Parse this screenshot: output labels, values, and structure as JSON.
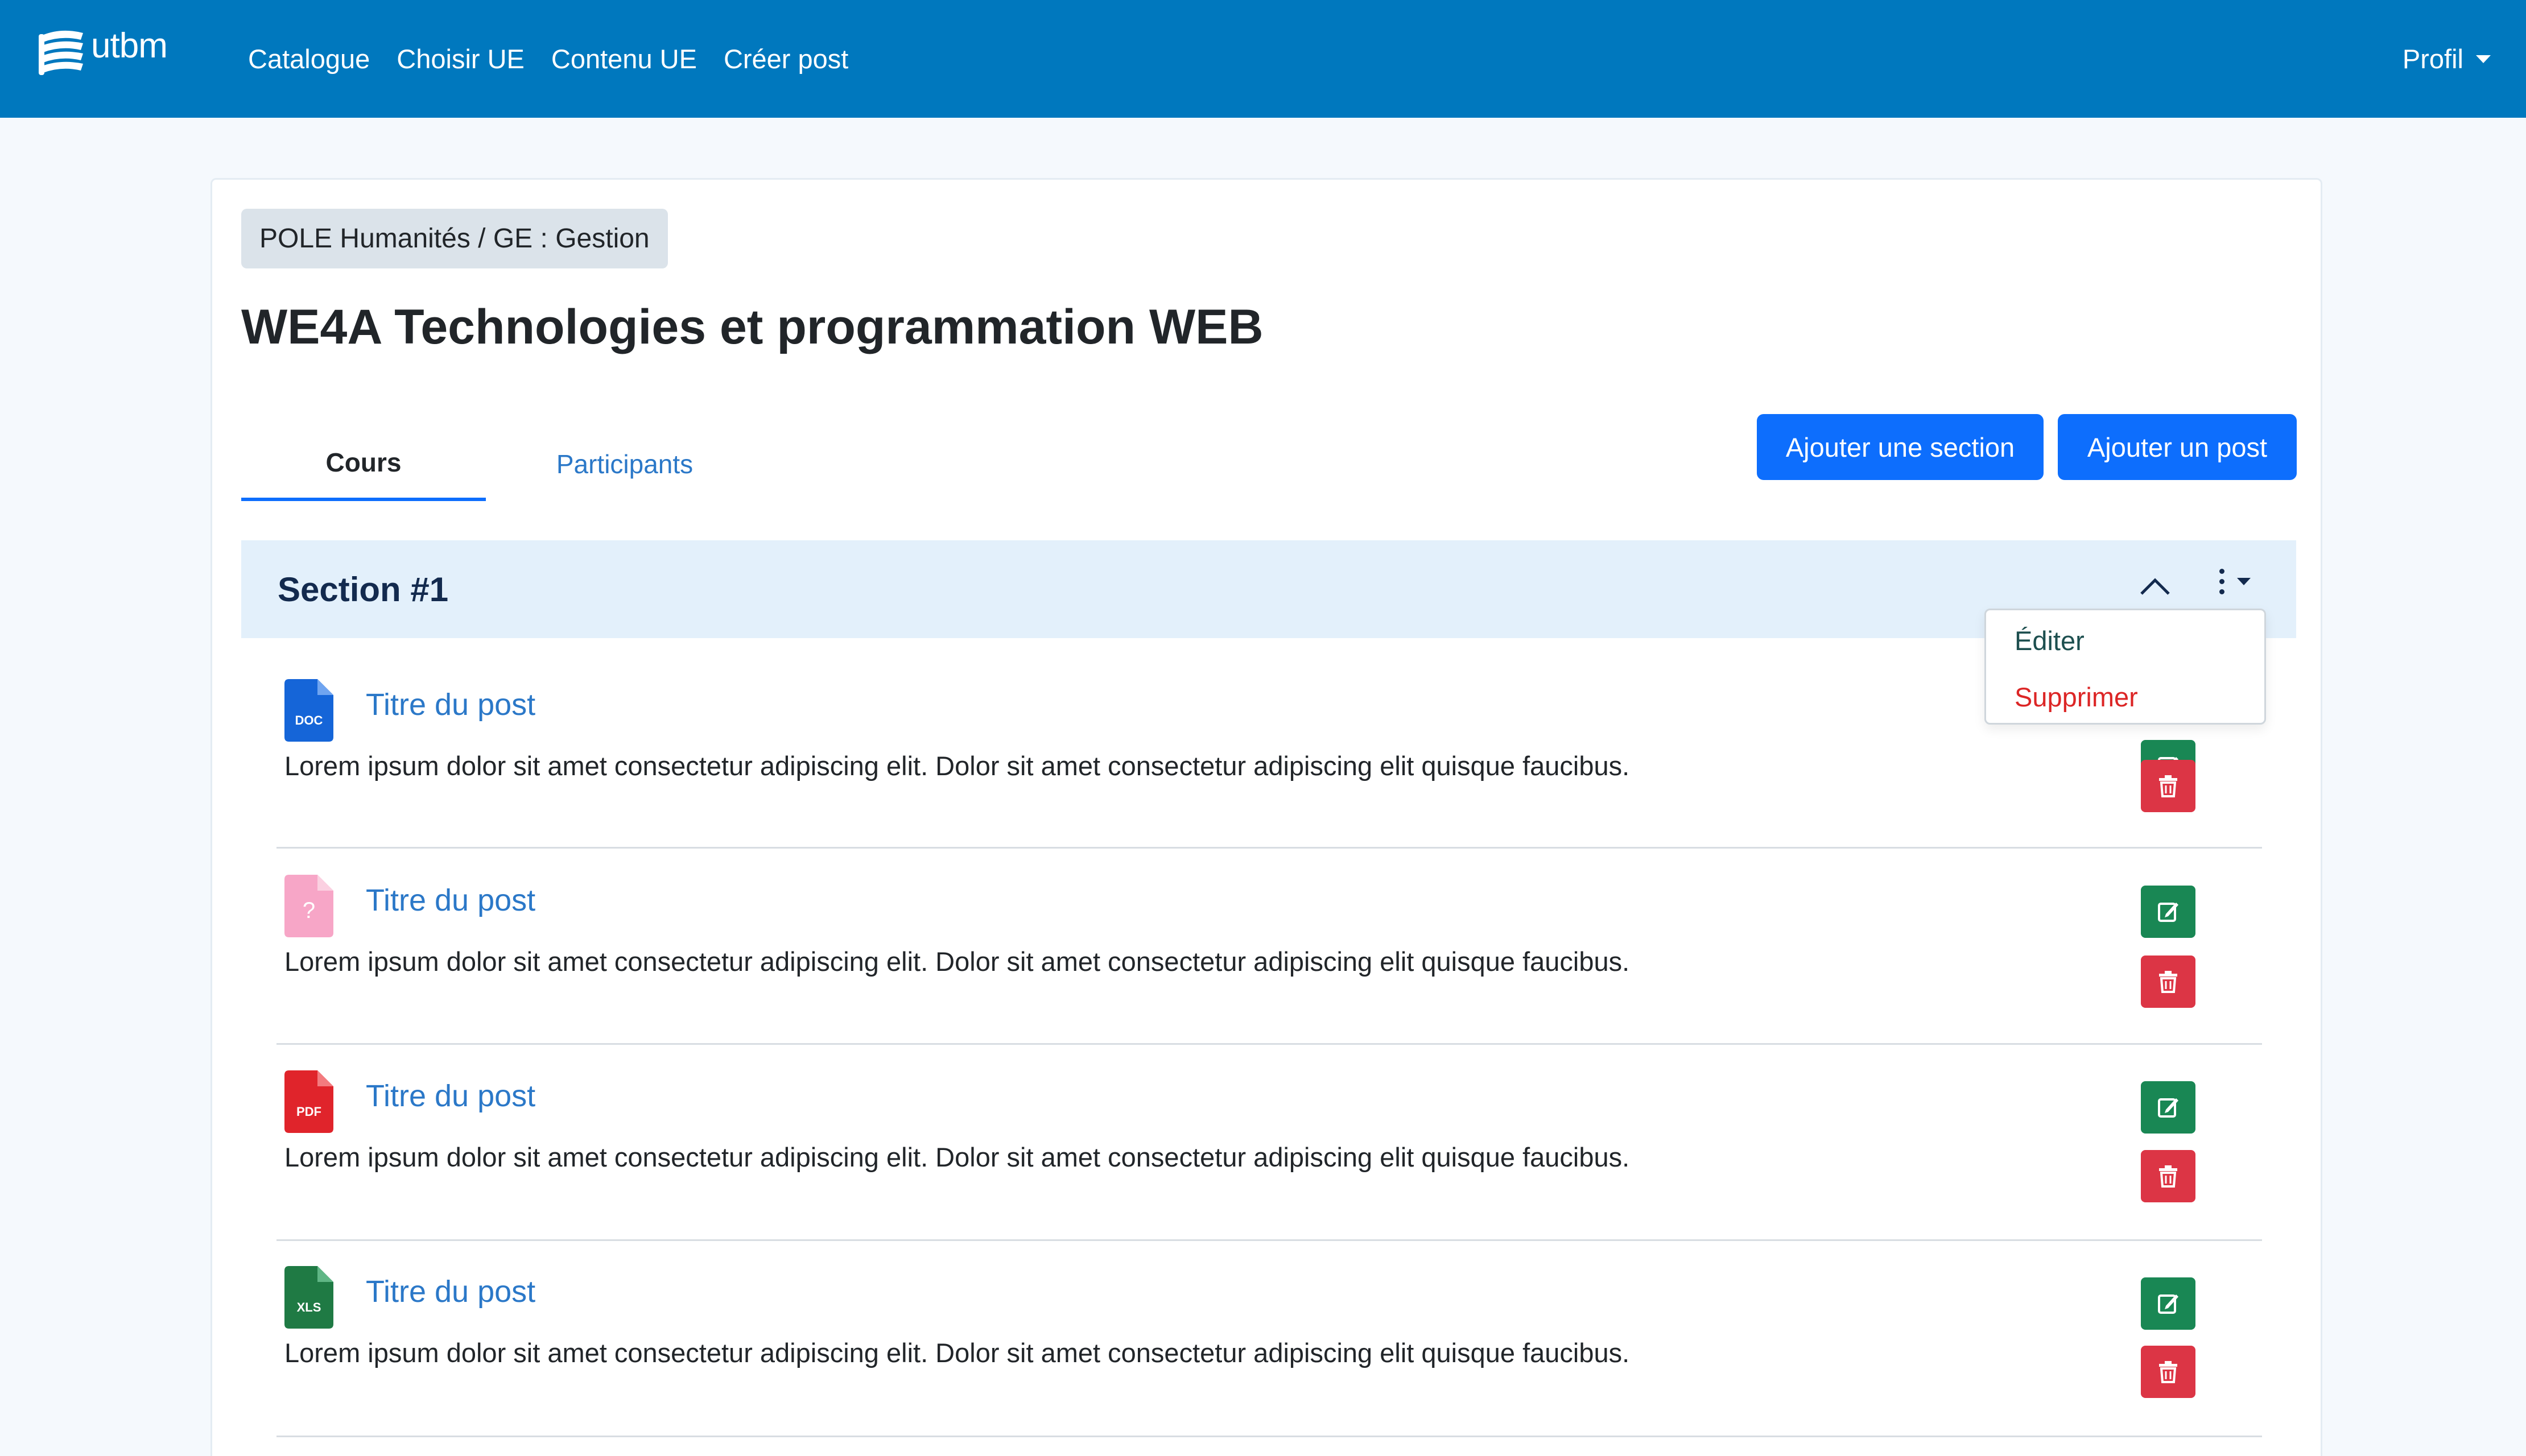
{
  "navbar": {
    "logo_text": "utbm",
    "links": [
      "Catalogue",
      "Choisir UE",
      "Contenu UE",
      "Créer post"
    ],
    "profile_label": "Profil"
  },
  "breadcrumb": "POLE Humanités / GE : Gestion",
  "page_title": "WE4A Technologies et programmation WEB",
  "tabs": [
    "Cours",
    "Participants"
  ],
  "buttons": {
    "add_section": "Ajouter une section",
    "add_post": "Ajouter un post"
  },
  "section": {
    "title": "Section #1",
    "menu": {
      "edit": "Éditer",
      "delete": "Supprimer"
    }
  },
  "posts": [
    {
      "title": "Titre du post",
      "description": "Lorem ipsum dolor sit amet consectetur adipiscing elit. Dolor sit amet consectetur adipiscing elit quisque faucibus.",
      "file_type": "DOC",
      "icon": "doc-file-icon",
      "color": "#1565d8"
    },
    {
      "title": "Titre du post",
      "description": "Lorem ipsum dolor sit amet consectetur adipiscing elit. Dolor sit amet consectetur adipiscing elit quisque faucibus.",
      "file_type": "?",
      "icon": "unknown-file-icon",
      "color": "#f7a6c7"
    },
    {
      "title": "Titre du post",
      "description": "Lorem ipsum dolor sit amet consectetur adipiscing elit. Dolor sit amet consectetur adipiscing elit quisque faucibus.",
      "file_type": "PDF",
      "icon": "pdf-file-icon",
      "color": "#e0242b"
    },
    {
      "title": "Titre du post",
      "description": "Lorem ipsum dolor sit amet consectetur adipiscing elit. Dolor sit amet consectetur adipiscing elit quisque faucibus.",
      "file_type": "XLS",
      "icon": "xls-file-icon",
      "color": "#1f7a44"
    }
  ],
  "colors": {
    "navbar": "#0078be",
    "primary": "#0d6efd",
    "edit": "#198754",
    "delete": "#dc3545",
    "section_bg": "#e3f0fb"
  }
}
